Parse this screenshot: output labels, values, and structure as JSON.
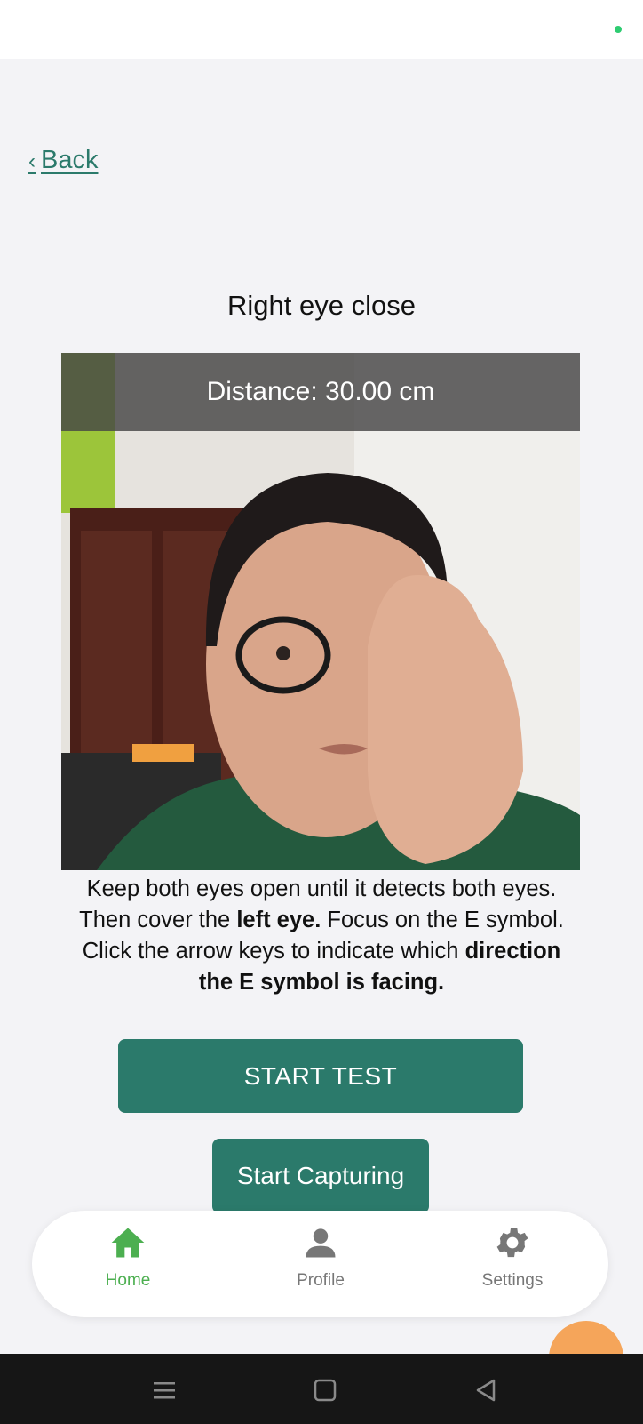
{
  "header": {
    "back_label": "Back",
    "title": "Right eye close"
  },
  "camera": {
    "distance_text": "Distance: 30.00 cm"
  },
  "instructions": {
    "line1": "Keep both eyes open until it detects both eyes.",
    "line2_pre": "Then cover the ",
    "line2_bold": "left eye.",
    "line2_post": " Focus on the E symbol.",
    "line3_pre": "Click the arrow keys to indicate which ",
    "line3_bold": "direction",
    "line4_bold": "the E symbol is facing."
  },
  "actions": {
    "start_test": "START TEST",
    "start_capturing": "Start Capturing"
  },
  "tabs": [
    {
      "label": "Home",
      "icon": "home-icon",
      "active": true
    },
    {
      "label": "Profile",
      "icon": "person-icon",
      "active": false
    },
    {
      "label": "Settings",
      "icon": "gear-icon",
      "active": false
    }
  ],
  "system_nav": {
    "icons": [
      "menu-icon",
      "home-square-icon",
      "back-triangle-icon"
    ]
  },
  "colors": {
    "accent": "#2b7a6b",
    "active_tab": "#4caf50",
    "inactive_tab": "#777777",
    "background": "#f3f3f6",
    "fab": "#f5a55a"
  }
}
